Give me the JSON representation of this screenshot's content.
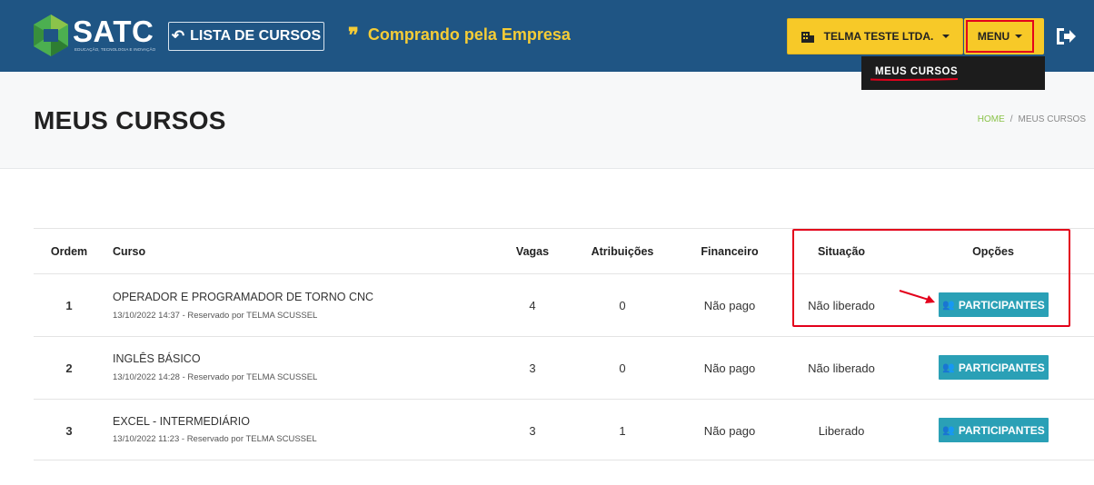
{
  "header": {
    "logo_text": "SATC",
    "logo_subtitle": "EDUCAÇÃO, TECNOLOGIA E INOVAÇÃO",
    "lista_button_label": "LISTA DE CURSOS",
    "buying_text": "Comprando pela Empresa",
    "company_button_label": "TELMA TESTE LTDA.",
    "menu_button_label": "MENU",
    "dropdown_items": [
      {
        "label": "MEUS CURSOS"
      }
    ]
  },
  "page": {
    "title": "MEUS CURSOS",
    "breadcrumb": {
      "home": "HOME",
      "separator": "/",
      "current": "MEUS CURSOS"
    }
  },
  "table": {
    "headers": {
      "ordem": "Ordem",
      "curso": "Curso",
      "vagas": "Vagas",
      "atribuicoes": "Atribuições",
      "financeiro": "Financeiro",
      "situacao": "Situação",
      "opcoes": "Opções"
    },
    "rows": [
      {
        "ordem": "1",
        "curso": "OPERADOR E PROGRAMADOR DE TORNO CNC",
        "meta": "13/10/2022 14:37 - Reservado por TELMA SCUSSEL",
        "vagas": "4",
        "atribuicoes": "0",
        "financeiro": "Não pago",
        "situacao": "Não liberado",
        "button": "PARTICIPANTES"
      },
      {
        "ordem": "2",
        "curso": "INGLÊS BÁSICO",
        "meta": "13/10/2022 14:28 - Reservado por TELMA SCUSSEL",
        "vagas": "3",
        "atribuicoes": "0",
        "financeiro": "Não pago",
        "situacao": "Não liberado",
        "button": "PARTICIPANTES"
      },
      {
        "ordem": "3",
        "curso": "EXCEL - INTERMEDIÁRIO",
        "meta": "13/10/2022 11:23 - Reservado por TELMA SCUSSEL",
        "vagas": "3",
        "atribuicoes": "1",
        "financeiro": "Não pago",
        "situacao": "Liberado",
        "button": "PARTICIPANTES"
      }
    ]
  },
  "colors": {
    "header_bg": "#1f5584",
    "accent_yellow": "#f7c928",
    "button_teal": "#2aa0b6",
    "annotation_red": "#e3001b",
    "breadcrumb_home": "#8bc34a"
  }
}
